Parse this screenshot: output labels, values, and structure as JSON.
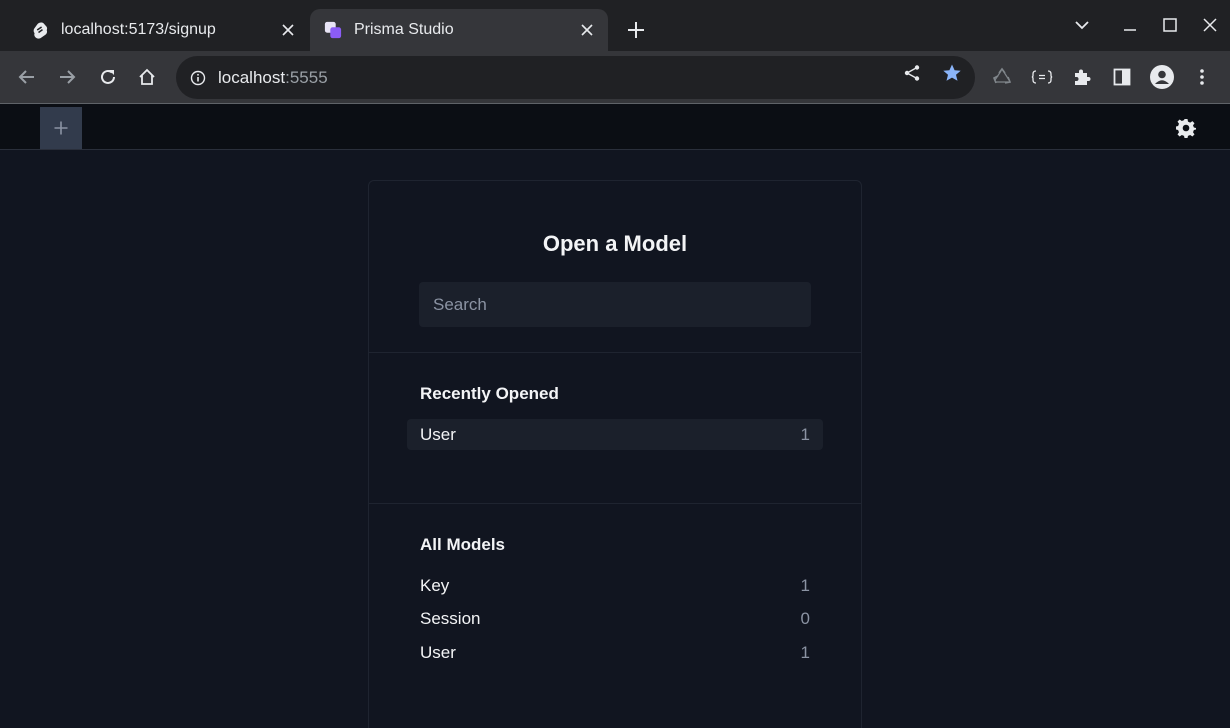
{
  "browser": {
    "tabs": [
      {
        "title": "localhost:5173/signup",
        "favicon": "svelte-icon",
        "active": false
      },
      {
        "title": "Prisma Studio",
        "favicon": "prisma-studio-icon",
        "active": true
      }
    ],
    "address": {
      "host": "localhost",
      "port": ":5555"
    },
    "colors": {
      "tabstrip": "#202124",
      "toolbar": "#35363a",
      "bookmark_star": "#8ab4f8"
    }
  },
  "studio": {
    "panel_title": "Open a Model",
    "search": {
      "placeholder": "Search",
      "value": ""
    },
    "recent": {
      "title": "Recently Opened",
      "items": [
        {
          "name": "User",
          "count": "1"
        }
      ]
    },
    "all_models": {
      "title": "All Models",
      "items": [
        {
          "name": "Key",
          "count": "1"
        },
        {
          "name": "Session",
          "count": "0"
        },
        {
          "name": "User",
          "count": "1"
        }
      ]
    },
    "colors": {
      "background": "#111520",
      "header": "#0b0e14",
      "add_tab": "#323b4c",
      "muted_text": "#8b93a3"
    }
  }
}
